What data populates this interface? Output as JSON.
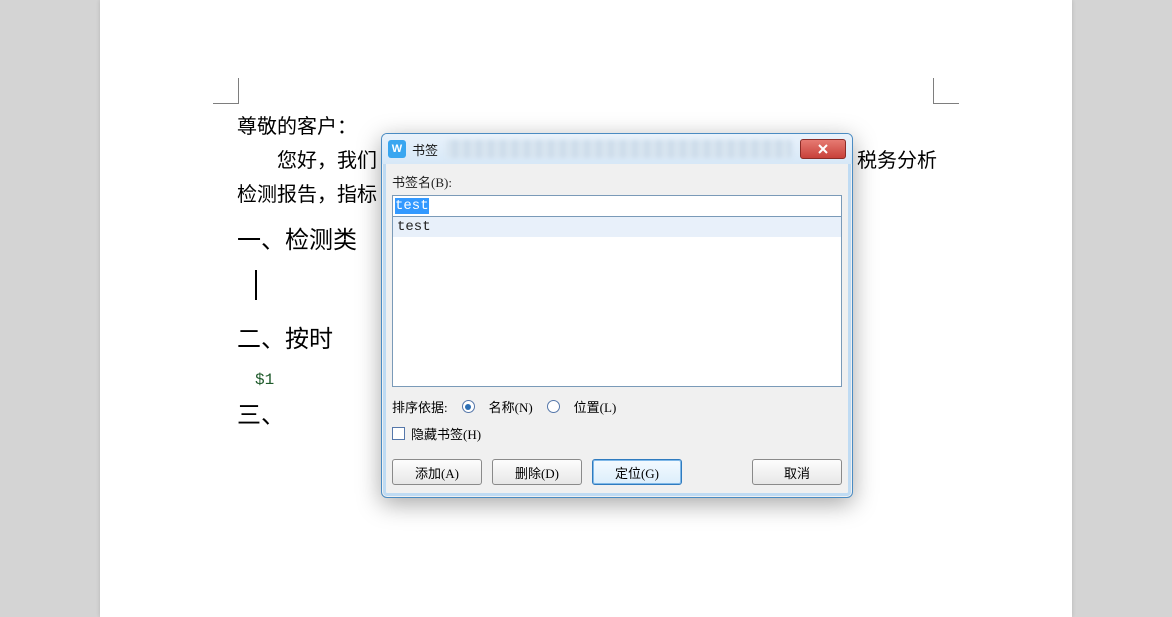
{
  "document": {
    "greeting": "尊敬的客户：",
    "hello_line": "您好，我们",
    "right_fragment": "税务分析",
    "line2": "检测报告，指标",
    "h1": "一、检测类",
    "h2": "二、按时",
    "placeholder": "$1",
    "h3": "三、"
  },
  "dialog": {
    "app_icon_letter": "W",
    "title": "书签",
    "name_label": "书签名(B):",
    "name_value": "test",
    "list_items": [
      "test"
    ],
    "sort_label": "排序依据:",
    "radio_name": "名称(N)",
    "radio_location": "位置(L)",
    "hide_label": "隐藏书签(H)",
    "buttons": {
      "add": "添加(A)",
      "delete": "删除(D)",
      "goto": "定位(G)",
      "cancel": "取消"
    }
  }
}
